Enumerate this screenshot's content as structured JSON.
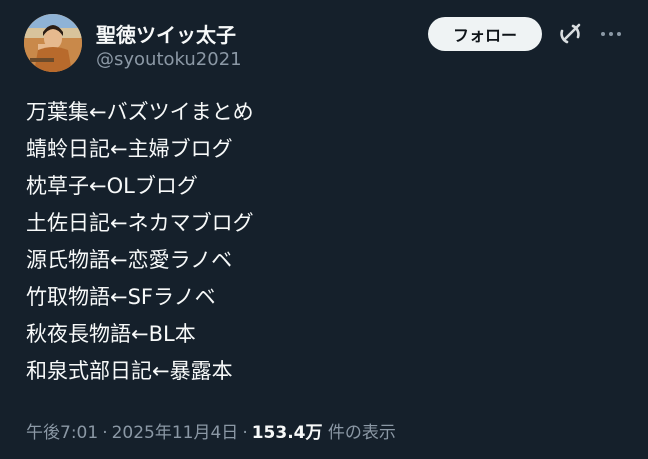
{
  "author": {
    "display_name": "聖徳ツイッ太子",
    "handle": "@syoutoku2021",
    "avatar_icon": "profile-avatar"
  },
  "actions": {
    "follow_label": "フォロー",
    "grok_icon": "grok-icon",
    "more_icon": "more-options-icon"
  },
  "tweet": {
    "lines": [
      "万葉集←バズツイまとめ",
      "蜻蛉日記←主婦ブログ",
      "枕草子←OLブログ",
      "土佐日記←ネカマブログ",
      "源氏物語←恋愛ラノベ",
      "竹取物語←SFラノベ",
      "秋夜長物語←BL本",
      "和泉式部日記←暴露本"
    ]
  },
  "meta": {
    "time": "午後7:01",
    "separator": "·",
    "date": "2025年11月4日",
    "views_count": "153.4万",
    "views_label": "件の表示"
  },
  "colors": {
    "background": "#15202b",
    "text": "#f7f9f9",
    "secondary": "#8b98a5",
    "button_bg": "#eff3f4"
  }
}
